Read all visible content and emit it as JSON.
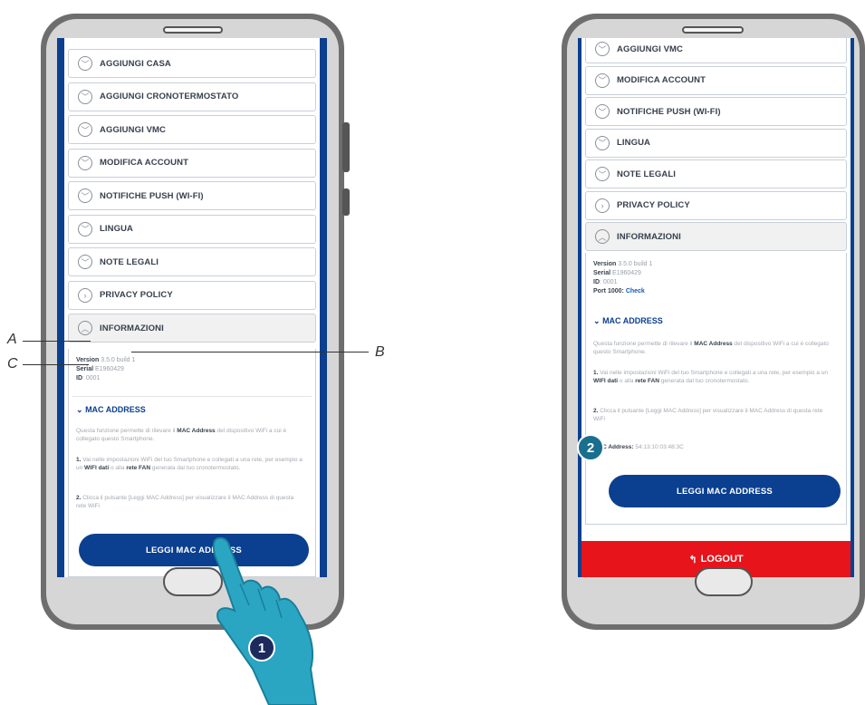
{
  "left_phone": {
    "menu": [
      {
        "icon": "chevron-down-icon",
        "label": "AGGIUNGI CASA"
      },
      {
        "icon": "chevron-down-icon",
        "label": "AGGIUNGI CRONOTERMOSTATO"
      },
      {
        "icon": "chevron-down-icon",
        "label": "AGGIUNGI VMC"
      },
      {
        "icon": "chevron-down-icon",
        "label": "MODIFICA ACCOUNT"
      },
      {
        "icon": "chevron-down-icon",
        "label": "NOTIFICHE PUSH (WI-FI)"
      },
      {
        "icon": "chevron-down-icon",
        "label": "LINGUA"
      },
      {
        "icon": "chevron-down-icon",
        "label": "NOTE LEGALI"
      },
      {
        "icon": "chevron-right-icon",
        "label": "PRIVACY POLICY"
      },
      {
        "icon": "chevron-up-icon",
        "label": "INFORMAZIONI"
      }
    ],
    "info": {
      "version_label": "Version",
      "version_value": "3.5.0 build 1",
      "serial_label": "Serial",
      "serial_value": "E1960429",
      "id_label": "ID",
      "id_value": "0001"
    },
    "mac_title": "MAC ADDRESS",
    "mac_text_1": "Questa funzione permette di rilevare il",
    "mac_text_1b": "MAC Address",
    "mac_text_1c": "del dispositivo WiFi a cui è collegato questo Smartphone.",
    "mac_step1_num": "1.",
    "mac_step1": "Vai nelle impostazioni WiFi del tuo Smartphone e collegati a una rete, per esempio a un",
    "mac_step1_b1": "WIFI dati",
    "mac_step1_m": "o alla",
    "mac_step1_b2": "rete FAN",
    "mac_step1_e": "generata dal tuo cronotermostato.",
    "mac_step2_num": "2.",
    "mac_step2": "Clicca il pulsante [Leggi MAC Address] per visualizzare il MAC Address di questa rete WiFi",
    "read_button": "LEGGI MAC ADDRESS"
  },
  "right_phone": {
    "menu": [
      {
        "icon": "chevron-down-icon",
        "label": "AGGIUNGI VMC"
      },
      {
        "icon": "chevron-down-icon",
        "label": "MODIFICA ACCOUNT"
      },
      {
        "icon": "chevron-down-icon",
        "label": "NOTIFICHE PUSH (WI-FI)"
      },
      {
        "icon": "chevron-down-icon",
        "label": "LINGUA"
      },
      {
        "icon": "chevron-down-icon",
        "label": "NOTE LEGALI"
      },
      {
        "icon": "chevron-right-icon",
        "label": "PRIVACY POLICY"
      },
      {
        "icon": "chevron-up-icon",
        "label": "INFORMAZIONI"
      }
    ],
    "info": {
      "version_label": "Version",
      "version_value": "3.5.0 build 1",
      "serial_label": "Serial",
      "serial_value": "E1960429",
      "id_label": "ID",
      "id_value": "0001",
      "port_label": "Port 1000:",
      "port_link": "Check"
    },
    "mac_title": "MAC ADDRESS",
    "mac_address_label": "MAC Address:",
    "mac_address_value": "54:13:10:03:48:3C",
    "read_button": "LEGGI MAC ADDRESS",
    "logout_button": "LOGOUT",
    "logout_icon": "reply-icon"
  },
  "callouts": {
    "a": "A",
    "b": "B",
    "c": "C"
  },
  "steps": {
    "one": "1",
    "two": "2"
  },
  "colors": {
    "brand_blue": "#0b3f8f",
    "logout_red": "#e8141b",
    "badge_teal": "#1a6f8f"
  }
}
